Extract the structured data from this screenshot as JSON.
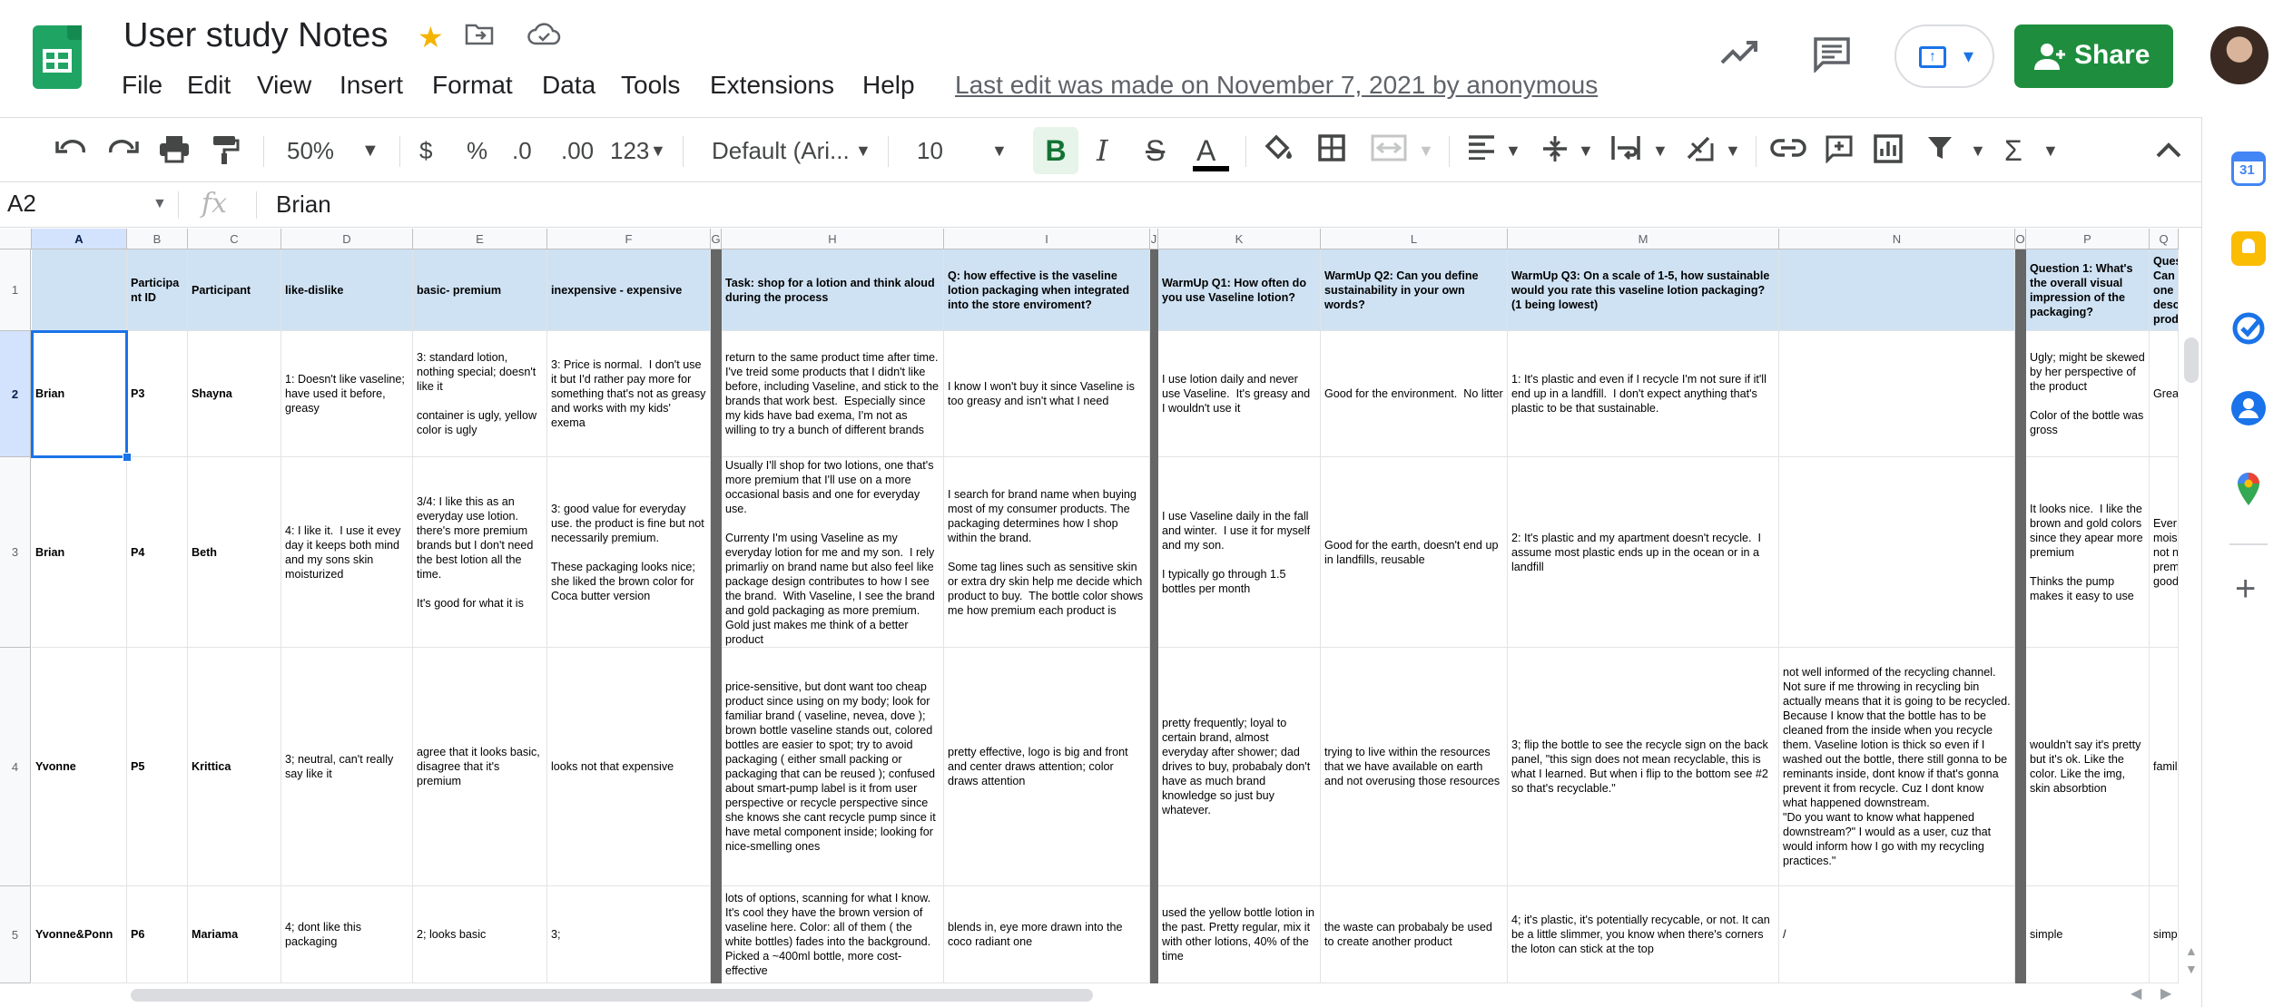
{
  "app": {
    "title": "User study Notes",
    "menu": [
      "File",
      "Edit",
      "View",
      "Insert",
      "Format",
      "Data",
      "Tools",
      "Extensions",
      "Help"
    ],
    "last_edit": "Last edit was made on November 7, 2021 by anonymous",
    "share_label": "Share"
  },
  "toolbar": {
    "zoom": "50%",
    "currency": "$",
    "percent": "%",
    "dec_decrease": ".0",
    "dec_increase": ".00",
    "more_formats": "123",
    "font": "Default (Ari...",
    "font_size": "10",
    "bold": "B",
    "italic": "I",
    "strike": "S",
    "text_color": "A"
  },
  "formula_bar": {
    "cell_ref": "A2",
    "fx": "fx",
    "value": "Brian"
  },
  "sheet": {
    "columns": [
      "A",
      "B",
      "C",
      "D",
      "E",
      "F",
      "G",
      "H",
      "I",
      "J",
      "K",
      "L",
      "M",
      "N",
      "O",
      "P",
      "Q"
    ],
    "rows": [
      "1",
      "2",
      "3",
      "4",
      "5"
    ],
    "header_row": [
      "",
      "Participa nt ID",
      "Participant",
      "like-dislike",
      "basic- premium",
      "inexpensive - expensive",
      "",
      "Task: shop for a lotion and think aloud during the process",
      "Q: how effective is the vaseline lotion packaging when integrated into the store enviroment?",
      "",
      "WarmUp Q1: How often do you use Vaseline lotion?",
      "WarmUp Q2: Can you define sustainability in your own words?",
      "WarmUp Q3: On a scale of 1-5, how sustainable would you rate this vaseline lotion packaging? (1 being lowest)",
      "",
      "",
      "Question 1: What's the overall visual impression of the packaging?",
      "Ques Can one desc prod"
    ],
    "data_rows": [
      [
        "Brian",
        "P3",
        "Shayna",
        "1: Doesn't like vaseline; have used it before, greasy",
        "3: standard lotion, nothing special; doesn't like it\n\ncontainer is ugly, yellow color is ugly",
        "3: Price is normal.  I don't use it but I'd rather pay more for something that's not as greasy and works with my kids' exema",
        "",
        "return to the same product time after time.  I've treid some products that I didn't like before, including Vaseline, and stick to the brands that work best.  Especially since my kids have bad exema, I'm not as willing to try a bunch of different brands",
        "I know I won't buy it since Vaseline is too greasy and isn't what I need",
        "",
        "I use lotion daily and never use Vaseline.  It's greasy and I wouldn't use it",
        "Good for the environment.  No litter",
        "1: It's plastic and even if I recycle I'm not sure if it'll end up in a landfill.  I don't expect anything that's plastic to be that sustainable.",
        "",
        "",
        "Ugly; might be skewed by her perspective of the product\n\nColor of the bottle was gross",
        "Grea"
      ],
      [
        "Brian",
        "P4",
        "Beth",
        "4: I like it.  I use it evey day it keeps both mind and my sons skin moisturized",
        "3/4: I like this as an everyday use lotion.  there's more premium brands but I don't need the best lotion all the time.\n\nIt's good for what it is",
        "3: good value for everyday use. the product is fine but not necessarily premium.\n\nThese packaging looks nice; she liked the brown color for Coca butter version",
        "",
        "Usually I'll shop for two lotions, one that's more premium that I'll use on a more occasional basis and one for everyday use.\n\nCurrenty I'm using Vaseline as my everyday lotion for me and my son.  I rely primarliy on brand name but also feel like package design contributes to how I see the brand.  With Vaseline, I see the brand and gold packaging as more premium.  Gold just makes me think of a better product",
        "I search for brand name when buying most of my consumer products. The packaging determines how I shop within the brand.\n\nSome tag lines such as sensitive skin or extra dry skin help me decide which product to buy.  The bottle color shows me how premium each product is",
        "",
        "I use Vaseline daily in the fall and winter.  I use it for myself and my son.\n\nI typically go through 1.5 bottles per month",
        "Good for the earth, doesn't end up in landfills, reusable",
        "2: It's plastic and my apartment doesn't recycle.  I assume most plastic ends up in the ocean or in a landfill",
        "",
        "",
        "It looks nice.  I like the brown and gold colors since they apear more premium\n\nThinks the pump makes it easy to use",
        "Ever mois not n prem good"
      ],
      [
        "Yvonne",
        "P5",
        "Krittica",
        "3; neutral, can't really say like it",
        "agree that it looks basic, disagree that it's premium",
        "looks not that expensive",
        "",
        "price-sensitive, but dont want too cheap product since using on my body; look for familiar brand ( vaseline, nevea, dove ); brown bottle vaseline stands out, colored bottles are easier to spot; try to avoid packaging ( either small packing or packaging that can be reused ); confused about smart-pump label is it from user perspective or recycle perspective since she knows she cant recycle pump since it have metal component inside; looking for nice-smelling ones",
        "pretty effective, logo is big and front and center draws attention; color draws attention",
        "",
        "pretty frequently; loyal to certain brand, almost everyday after shower; dad drives to buy, probabaly don't have as much brand knowledge so just buy whatever.",
        "trying to live within the resources that we have available on earth and not overusing those resources",
        "3; flip the bottle to see the recycle sign on the back panel, \"this sign does not mean recyclable, this is what I learned. But when i flip to the bottom see #2 so that's recyclable.\"",
        "not well informed of the recycling channel. Not sure if me throwing in recycling bin actually means that it is going to be recycled. Because I know that the bottle has to be cleaned from the inside when you recycle them. Vaseline lotion is thick so even if I washed out the bottle, there still gonna to be reminants inside, dont know if that's gonna prevent it from recycle. Cuz I dont know what happened downstream.\n\"Do you want to know what happened downstream?\" I would as a user, cuz that would inform how I go with my recycling practices.\"",
        "",
        "wouldn't say it's pretty but it's ok. Like the color. Like the img, skin absorbtion",
        "famil"
      ],
      [
        "Yvonne&Ponn",
        "P6",
        "Mariama",
        "4; dont like this packaging",
        "2; looks basic",
        "3;",
        "",
        "lots of options, scanning for what I know. It's cool they have the brown version of vaseline here. Color: all of them ( the white bottles) fades into the background. Picked a ~400ml bottle, more cost-effective",
        "blends in, eye more drawn into the coco radiant one",
        "",
        "used the yellow bottle lotion in the past. Pretty regular, mix it with other lotions, 40% of the time",
        "the waste can probabaly be used to create another product",
        "4; it's plastic, it's potentially recycable, or not. It can be a little slimmer, you know when there's corners the loton can stick at the top",
        "/",
        "",
        "simple",
        "simp"
      ]
    ]
  },
  "colors": {
    "header_fill": "#cfe2f3",
    "share_green": "#1e8e3e",
    "selection": "#1a73e8",
    "divider": "#666666"
  }
}
